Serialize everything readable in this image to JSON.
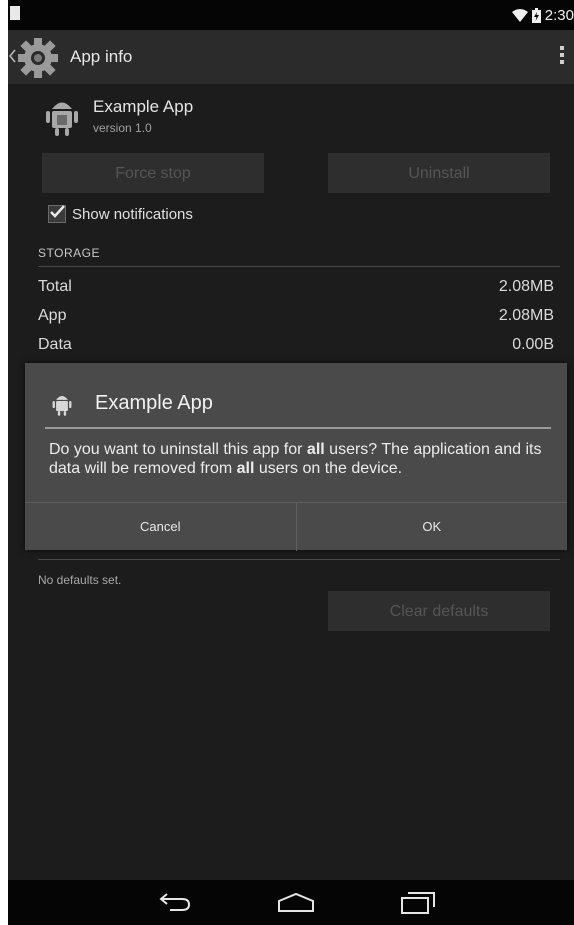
{
  "status_bar": {
    "time": "2:30",
    "icons": [
      "notification-icon",
      "wifi-icon",
      "battery-icon"
    ]
  },
  "action_bar": {
    "title": "App info",
    "icons": [
      "up-icon",
      "app-settings-gear-icon",
      "overflow-menu-icon"
    ]
  },
  "app": {
    "name": "Example App",
    "version": "version 1.0",
    "icon": "android-robot-icon"
  },
  "buttons": {
    "force_stop": "Force stop",
    "uninstall": "Uninstall",
    "clear_defaults": "Clear defaults"
  },
  "notifications": {
    "label": "Show notifications",
    "checked": true
  },
  "storage": {
    "header": "STORAGE",
    "rows": [
      {
        "label": "Total",
        "value": "2.08MB"
      },
      {
        "label": "App",
        "value": "2.08MB"
      },
      {
        "label": "Data",
        "value": "0.00B"
      }
    ]
  },
  "defaults": {
    "message": "No defaults set."
  },
  "dialog": {
    "title": "Example App",
    "message_part1": "Do you want to uninstall this app for ",
    "message_bold1": "all",
    "message_part2": " users? The application and its data will be removed from ",
    "message_bold2": "all",
    "message_part3": " users on the device.",
    "cancel_label": "Cancel",
    "ok_label": "OK"
  },
  "nav_bar": {
    "icons": [
      "back-icon",
      "home-icon",
      "recent-apps-icon"
    ]
  },
  "colors": {
    "background": "#1c1c1c",
    "action_bar": "#2b2b2b",
    "dialog": "#4a4a4a"
  }
}
